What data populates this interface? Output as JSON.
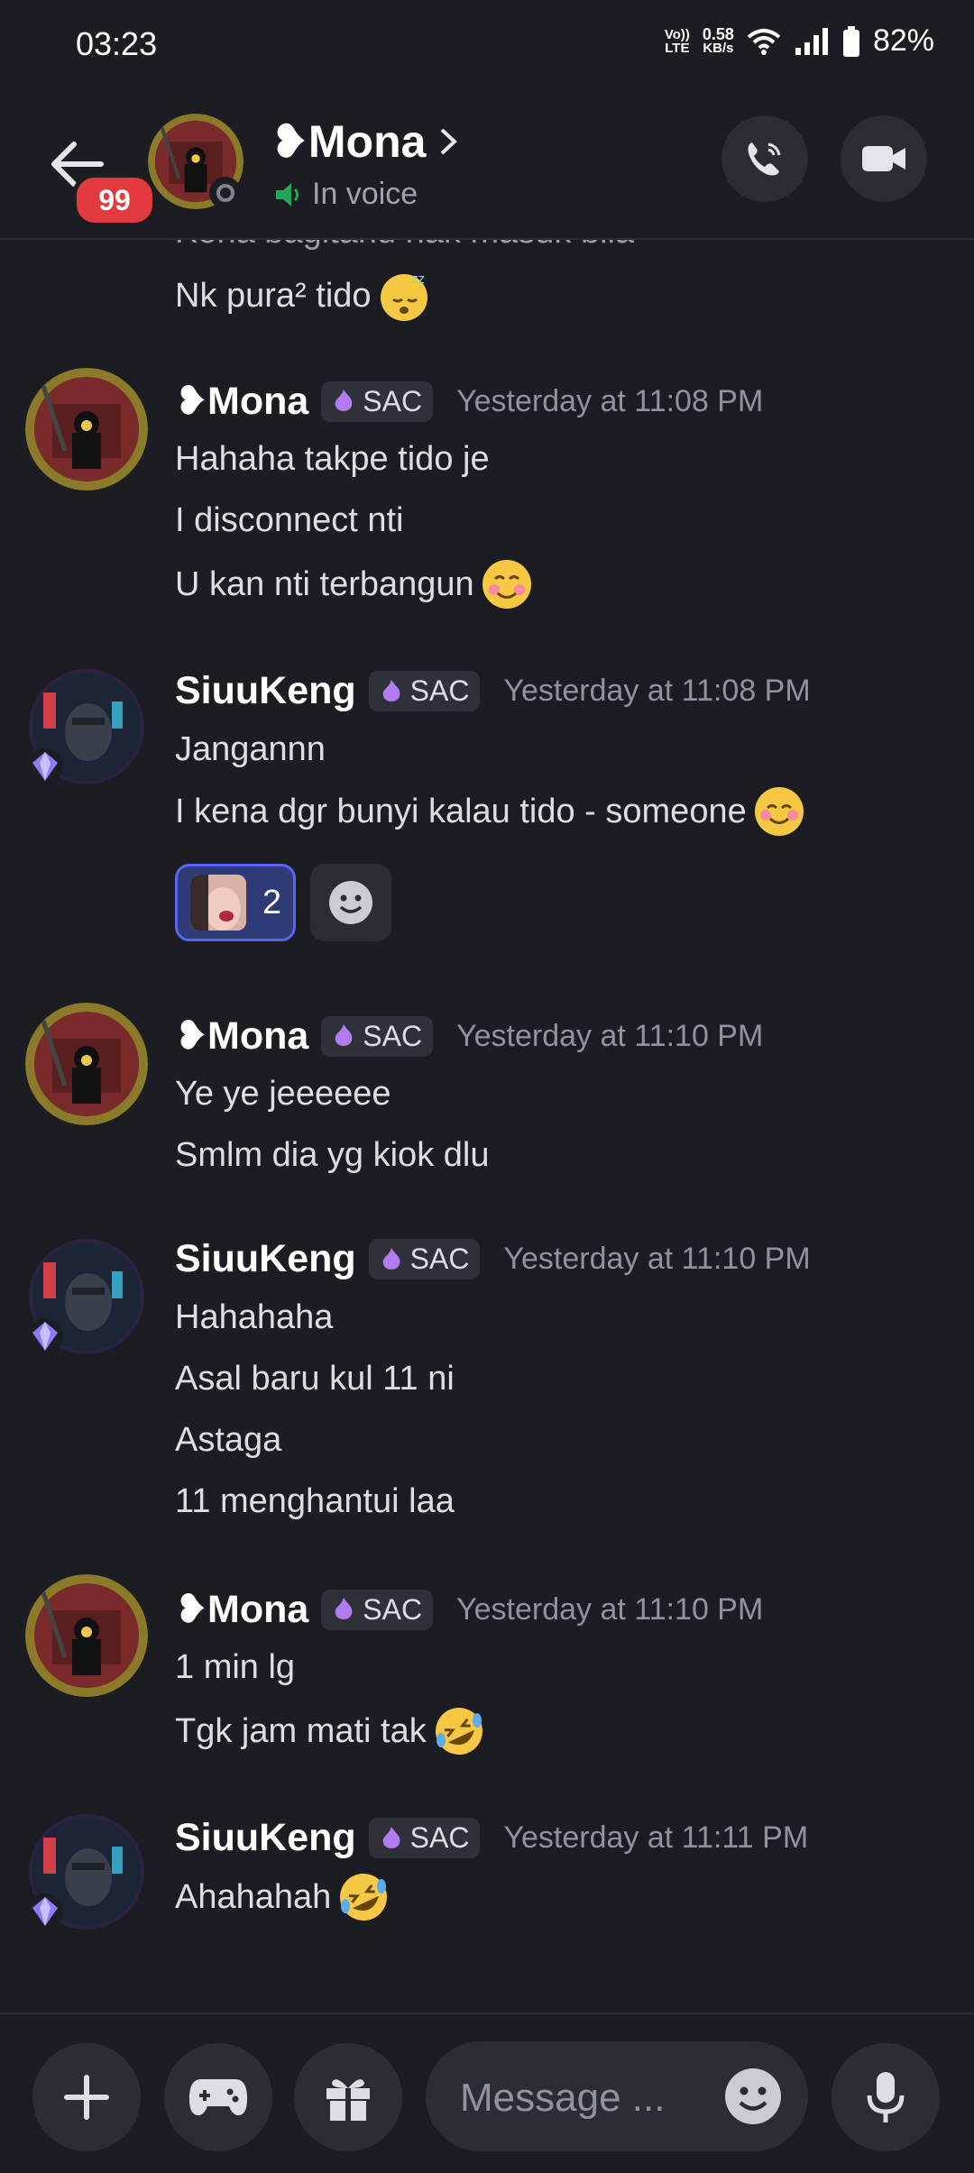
{
  "status_bar": {
    "time": "03:23",
    "net_top": "0.58",
    "net_bottom": "KB/s",
    "lte_top": "Vo))",
    "lte_bottom": "LTE",
    "battery": "82%"
  },
  "header": {
    "badge": "99",
    "name": "❥Mona",
    "status": "In voice",
    "accent": "#e23a3f"
  },
  "partial_messages": [
    {
      "text": "Kena bagitahu nak masuk bila"
    },
    {
      "text": "Nk pura² tido"
    }
  ],
  "messages": [
    {
      "author": "❥Mona",
      "tag": "SAC",
      "time": "Yesterday at 11:08 PM",
      "lines": [
        "Hahaha takpe tido je",
        "I disconnect nti",
        "U kan nti terbangun"
      ]
    },
    {
      "author": "SiuuKeng",
      "tag": "SAC",
      "time": "Yesterday at 11:08 PM",
      "lines": [
        "Jangannn",
        "I kena dgr bunyi kalau tido - someone"
      ],
      "reaction": {
        "count": "2"
      }
    },
    {
      "author": "❥Mona",
      "tag": "SAC",
      "time": "Yesterday at 11:10 PM",
      "lines": [
        "Ye ye jeeeeee",
        "Smlm dia yg kiok dlu"
      ]
    },
    {
      "author": "SiuuKeng",
      "tag": "SAC",
      "time": "Yesterday at 11:10 PM",
      "lines": [
        "Hahahaha",
        "Asal baru kul 11 ni",
        "Astaga",
        "11 menghantui laa"
      ]
    },
    {
      "author": "❥Mona",
      "tag": "SAC",
      "time": "Yesterday at 11:10 PM",
      "lines": [
        "1 min lg",
        "Tgk jam mati tak"
      ]
    },
    {
      "author": "SiuuKeng",
      "tag": "SAC",
      "time": "Yesterday at 11:11 PM",
      "lines": [
        "Ahahahah"
      ]
    }
  ],
  "composer": {
    "placeholder": "Message ..."
  }
}
